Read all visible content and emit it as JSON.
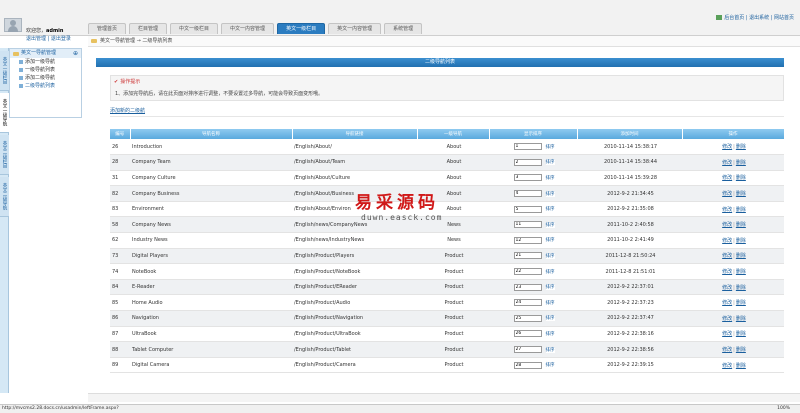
{
  "header": {
    "welcome_prefix": "欢迎您，",
    "username": "admin",
    "user_links": "退出管理 | 退出登录",
    "top_links": "后台首页 | 退出系统 | 网站首页"
  },
  "tabs": [
    "管理首页",
    "栏目管理",
    "中文一级栏目",
    "中文一内容管理",
    "英文一级栏目",
    "英文一内容管理",
    "系统管理"
  ],
  "active_tab_index": 4,
  "breadcrumb": "英文一导航管理 → 二级导航列表",
  "vtabs": [
    "英文一级栏目",
    "英文一级导航",
    "英文二级栏目",
    "英文二级导航"
  ],
  "tree": {
    "title": "英文一导航管理",
    "items": [
      "添加一级导航",
      "一级导航列表",
      "添加二级导航",
      "二级导航列表"
    ]
  },
  "page_title": "二级导航列表",
  "tips": {
    "title": "操作提示",
    "text": "1、添加完导航后，请在此页面对排序进行调整，不要设置过多导航，可能会导致页面变形哦。"
  },
  "add_link": "添加新的二级航",
  "table": {
    "headers": [
      "编号",
      "导航名称",
      "导航链接",
      "一级导航",
      "显示排序",
      "添加时间",
      "操作"
    ],
    "sort_button": "排序",
    "edit_label": "修改",
    "delete_label": "删除",
    "rows": [
      {
        "id": "26",
        "name": "Introduction",
        "link": "/English/About/",
        "parent": "About",
        "sort": "1",
        "time": "2010-11-14 15:38:17"
      },
      {
        "id": "28",
        "name": "Company Team",
        "link": "/English/About/Team",
        "parent": "About",
        "sort": "2",
        "time": "2010-11-14 15:38:44"
      },
      {
        "id": "31",
        "name": "Company Culture",
        "link": "/English/About/Culture",
        "parent": "About",
        "sort": "3",
        "time": "2010-11-14 15:39:28"
      },
      {
        "id": "82",
        "name": "Company Business",
        "link": "/English/About/Business",
        "parent": "About",
        "sort": "4",
        "time": "2012-9-2 21:34:45"
      },
      {
        "id": "83",
        "name": "Environment",
        "link": "/English/About/Environ",
        "parent": "About",
        "sort": "5",
        "time": "2012-9-2 21:35:08"
      },
      {
        "id": "58",
        "name": "Company News",
        "link": "/English/news/CompanyNews",
        "parent": "News",
        "sort": "11",
        "time": "2011-10-2 2:40:58"
      },
      {
        "id": "62",
        "name": "Industry News",
        "link": "/English/news/IndustryNews",
        "parent": "News",
        "sort": "12",
        "time": "2011-10-2 2:41:49"
      },
      {
        "id": "73",
        "name": "Digital Players",
        "link": "/English/Product/Players",
        "parent": "Product",
        "sort": "21",
        "time": "2011-12-8 21:50:24"
      },
      {
        "id": "74",
        "name": "NoteBook",
        "link": "/English/Product/NoteBook",
        "parent": "Product",
        "sort": "22",
        "time": "2011-12-8 21:51:01"
      },
      {
        "id": "84",
        "name": "E-Reader",
        "link": "/English/Product/EReader",
        "parent": "Product",
        "sort": "23",
        "time": "2012-9-2 22:37:01"
      },
      {
        "id": "85",
        "name": "Home Audio",
        "link": "/English/Product/Audio",
        "parent": "Product",
        "sort": "24",
        "time": "2012-9-2 22:37:23"
      },
      {
        "id": "86",
        "name": "Navigation",
        "link": "/English/Product/Navigation",
        "parent": "Product",
        "sort": "25",
        "time": "2012-9-2 22:37:47"
      },
      {
        "id": "87",
        "name": "UltraBook",
        "link": "/English/Product/UltraBook",
        "parent": "Product",
        "sort": "26",
        "time": "2012-9-2 22:38:16"
      },
      {
        "id": "88",
        "name": "Tablet Computer",
        "link": "/English/Product/Tablet",
        "parent": "Product",
        "sort": "27",
        "time": "2012-9-2 22:38:56"
      },
      {
        "id": "89",
        "name": "Digital Camera",
        "link": "/English/Product/Camera",
        "parent": "Product",
        "sort": "28",
        "time": "2012-9-2 22:39:15"
      }
    ]
  },
  "watermark": {
    "main": "易采源码",
    "sub": "duwn.easck.com"
  },
  "status": {
    "url": "http://mvcms2.28.docs.cn/usadmin/leftFrame.aspx?",
    "zoom": "100%"
  },
  "colors": {
    "accent": "#2b7cc0",
    "header_gradient": "#5aa9dd",
    "row_alt": "#eff1f3",
    "link": "#1a5f9e"
  }
}
